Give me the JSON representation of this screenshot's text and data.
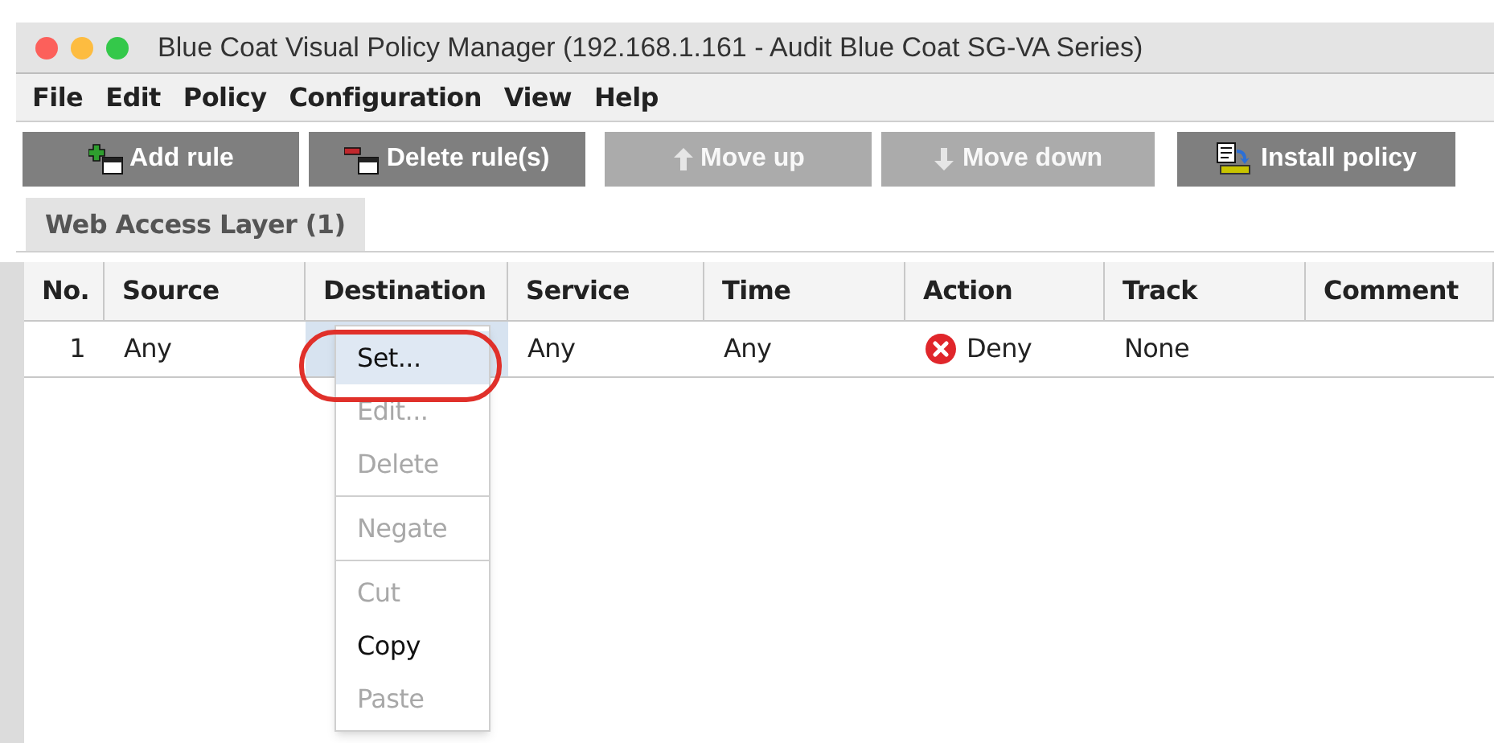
{
  "window": {
    "title": "Blue Coat Visual Policy Manager (192.168.1.161 - Audit Blue Coat SG-VA Series)"
  },
  "menu_bar": [
    "File",
    "Edit",
    "Policy",
    "Configuration",
    "View",
    "Help"
  ],
  "toolbar": [
    {
      "label": "Add rule",
      "kind": "add",
      "disabled": false
    },
    {
      "label": "Delete rule(s)",
      "kind": "delete",
      "disabled": false
    },
    {
      "label": "Move up",
      "kind": "up",
      "disabled": true
    },
    {
      "label": "Move down",
      "kind": "down",
      "disabled": true
    },
    {
      "label": "Install policy",
      "kind": "install",
      "disabled": false
    }
  ],
  "tabs": [
    {
      "label": "Web Access Layer (1)",
      "selected": true
    }
  ],
  "table": {
    "columns": [
      "No.",
      "Source",
      "Destination",
      "Service",
      "Time",
      "Action",
      "Track",
      "Comment"
    ],
    "rows": [
      {
        "cells": [
          "1",
          "Any",
          "",
          "Any",
          "Any",
          "Deny",
          "None",
          ""
        ],
        "kind": "deny"
      }
    ]
  },
  "context_menu": {
    "groups": [
      [
        {
          "label": "Set...",
          "disabled": false,
          "selected": true,
          "circled": true
        },
        {
          "label": "Edit...",
          "disabled": true,
          "selected": false,
          "circled": false
        },
        {
          "label": "Delete",
          "disabled": true,
          "selected": false,
          "circled": false
        }
      ],
      [
        {
          "label": "Negate",
          "disabled": true,
          "selected": false,
          "circled": false
        }
      ],
      [
        {
          "label": "Cut",
          "disabled": true,
          "selected": false,
          "circled": false
        },
        {
          "label": "Copy",
          "disabled": false,
          "selected": false,
          "circled": false
        },
        {
          "label": "Paste",
          "disabled": true,
          "selected": false,
          "circled": false
        }
      ]
    ]
  }
}
